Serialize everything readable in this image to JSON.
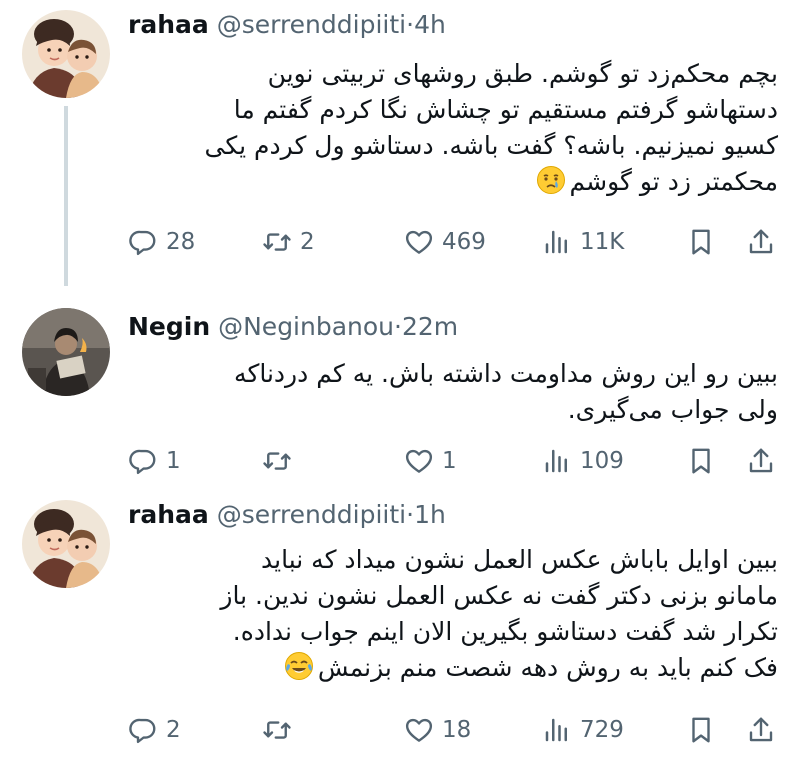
{
  "tweets": [
    {
      "name": "rahaa",
      "handle": "@serrenddipiiti",
      "dot": "·",
      "time": "4h",
      "lines": [
        "بچم محکم‌زد تو گوشم. طبق روشهای تربیتی نوین",
        "دستهاشو گرفتم مستقیم تو چشاش نگا کردم گفتم ما",
        "کسیو نمیزنیم. باشه؟ گفت باشه. دستاشو ول کردم یکی",
        "محکمتر زد تو گوشم"
      ],
      "emoji": "crying-face",
      "replies": "28",
      "reposts": "2",
      "likes": "469",
      "views": "11K"
    },
    {
      "name": "Negin",
      "handle": "@Neginbanou",
      "dot": "·",
      "time": "22m",
      "lines": [
        "ببین رو این روش مداومت داشته باش. یه کم دردناکه",
        "ولی جواب می‌گیری."
      ],
      "replies": "1",
      "reposts": "",
      "likes": "1",
      "views": "109"
    },
    {
      "name": "rahaa",
      "handle": "@serrenddipiiti",
      "dot": "·",
      "time": "1h",
      "lines": [
        "ببین اوایل باباش عکس العمل نشون میداد که نباید",
        "مامانو بزنی دکتر گفت نه عکس العمل نشون ندین. باز",
        "تکرار شد گفت دستاشو بگیرین الان اینم جواب نداده.",
        "فک کنم باید به روش دهه شصت منم بزنمش"
      ],
      "emoji": "tears-of-joy",
      "replies": "2",
      "reposts": "",
      "likes": "18",
      "views": "729"
    }
  ],
  "colors": {
    "text": "#0f1419",
    "muted": "#536471",
    "thread_line": "#cfd9de",
    "emoji_yellow": "#ffcc33",
    "tear_blue": "#5aa8e8"
  }
}
